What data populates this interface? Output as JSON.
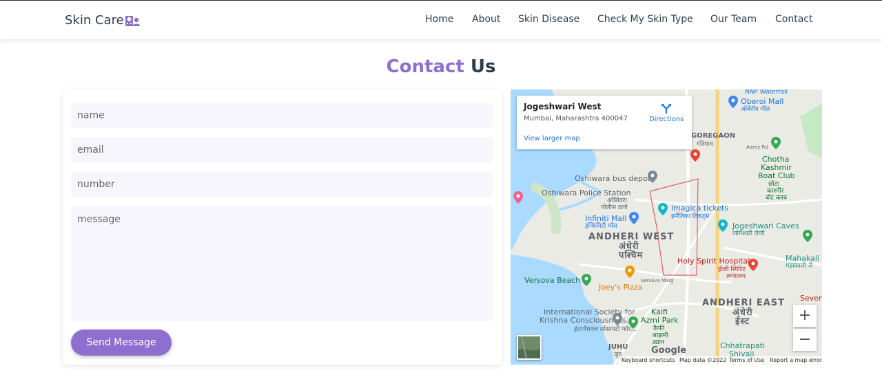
{
  "brand": {
    "name": "Skin Care",
    "icon": "hospital-user-icon",
    "accent": "#8e6fcf",
    "text_color": "#2c3e50"
  },
  "nav": {
    "items": [
      "Home",
      "About",
      "Skin Disease",
      "Check My Skin Type",
      "Our Team",
      "Contact"
    ]
  },
  "page": {
    "title_accent": "Contact",
    "title_rest": "Us"
  },
  "form": {
    "name_placeholder": "name",
    "email_placeholder": "email",
    "number_placeholder": "number",
    "message_placeholder": "message",
    "submit_label": "Send Message"
  },
  "map": {
    "place_title": "Jogeshwari West",
    "place_address": "Mumbai, Maharashtra 400047",
    "directions_label": "Directions",
    "larger_map_label": "View larger map",
    "zoom_in": "+",
    "zoom_out": "−",
    "google_logo": "Google",
    "attribution": [
      "Keyboard shortcuts",
      "Map data ©2022",
      "Terms of Use",
      "Report a map error"
    ],
    "labels": {
      "nnp": "NNP Waterfall",
      "oberoi": "Oberoi Mall",
      "oberoi_hi": "ओबेरॉय मॉल",
      "goregaon": "GOREGAON",
      "goregaon_hi": "गोरेगाव",
      "aarey": "Aarey Rd",
      "chotha1": "Chotha",
      "chotha2": "Kashmir",
      "chotha3": "Boat Club",
      "chotha_hi1": "छोटा",
      "chotha_hi2": "काश्मीर",
      "chotha_hi3": "बोट क्लब",
      "oshiwara_bus": "Oshiwara bus depot",
      "oshiwara_police": "Oshiwara Police Station",
      "oshiwara_police_hi1": "ओशिवरा",
      "oshiwara_police_hi2": "पोलीस ठाणे",
      "imagica": "imagica tickets",
      "imagica_hi": "इमॅजिका टिकट्स",
      "infiniti": "Infiniti Mall",
      "infiniti_hi": "इन्फिनिटी मॉल",
      "jogeshwari_caves": "Jogeshwari Caves",
      "jogeshwari_caves_hi": "जोगेश्वरी लेणी",
      "andheri_west": "ANDHERI WEST",
      "andheri_west_hi1": "अंधेरी",
      "andheri_west_hi2": "पश्चिम",
      "mahakali": "Mahakali C",
      "mahakali_hi": "महाकाली ले",
      "holy_spirit": "Holy Spirit Hospital",
      "holy_spirit_hi1": "होली स्पिरिट",
      "holy_spirit_hi2": "रुग्णालय",
      "versova_beach": "Versova Beach",
      "joeys": "Joey's Pizza",
      "versova_marg": "Versova Marg",
      "andheri_east": "ANDHERI EAST",
      "andheri_east_hi1": "अंधेरी",
      "andheri_east_hi2": "ईस्ट",
      "seven": "Seven",
      "iskcon1": "International Society for",
      "iskcon2": "Krishna Consciousness...",
      "iskcon_hi": "इंटरनॅशनल सोसायटी फॉर...",
      "kaifi1": "Kaifi",
      "kaifi2": "Azmi Park",
      "kaifi_hi1": "कैफी",
      "kaifi_hi2": "आझमी",
      "kaifi_hi3": "उद्यान",
      "juhu": "JUHU",
      "juhu_hi": "जुहू",
      "chhatrapati1": "Chhatrapati",
      "chhatrapati2": "Shivaji"
    }
  }
}
